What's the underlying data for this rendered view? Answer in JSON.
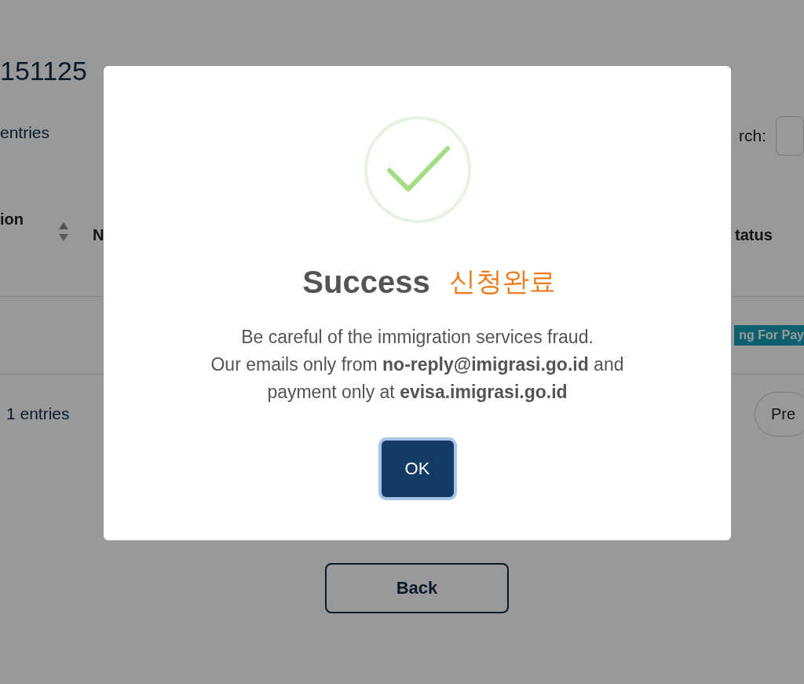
{
  "page": {
    "title": "151125",
    "length_label": "entries",
    "search_label": "rch:",
    "columns": [
      {
        "label": "ion",
        "sortable": true
      },
      {
        "label": "N"
      },
      {
        "label": "tatus"
      }
    ],
    "rows": [
      {
        "status": "ng For Pay"
      }
    ],
    "info": "1 entries",
    "pagination": [
      "Pre"
    ],
    "back_button": "Back"
  },
  "dialog": {
    "title": "Success",
    "annotation": "신청완료",
    "message": "Be careful of the immigration services fraud.\nOur emails only from **no-reply@imigrasi.go.id** and\npayment only at **evisa.imigrasi.go.id**",
    "button": "OK"
  }
}
